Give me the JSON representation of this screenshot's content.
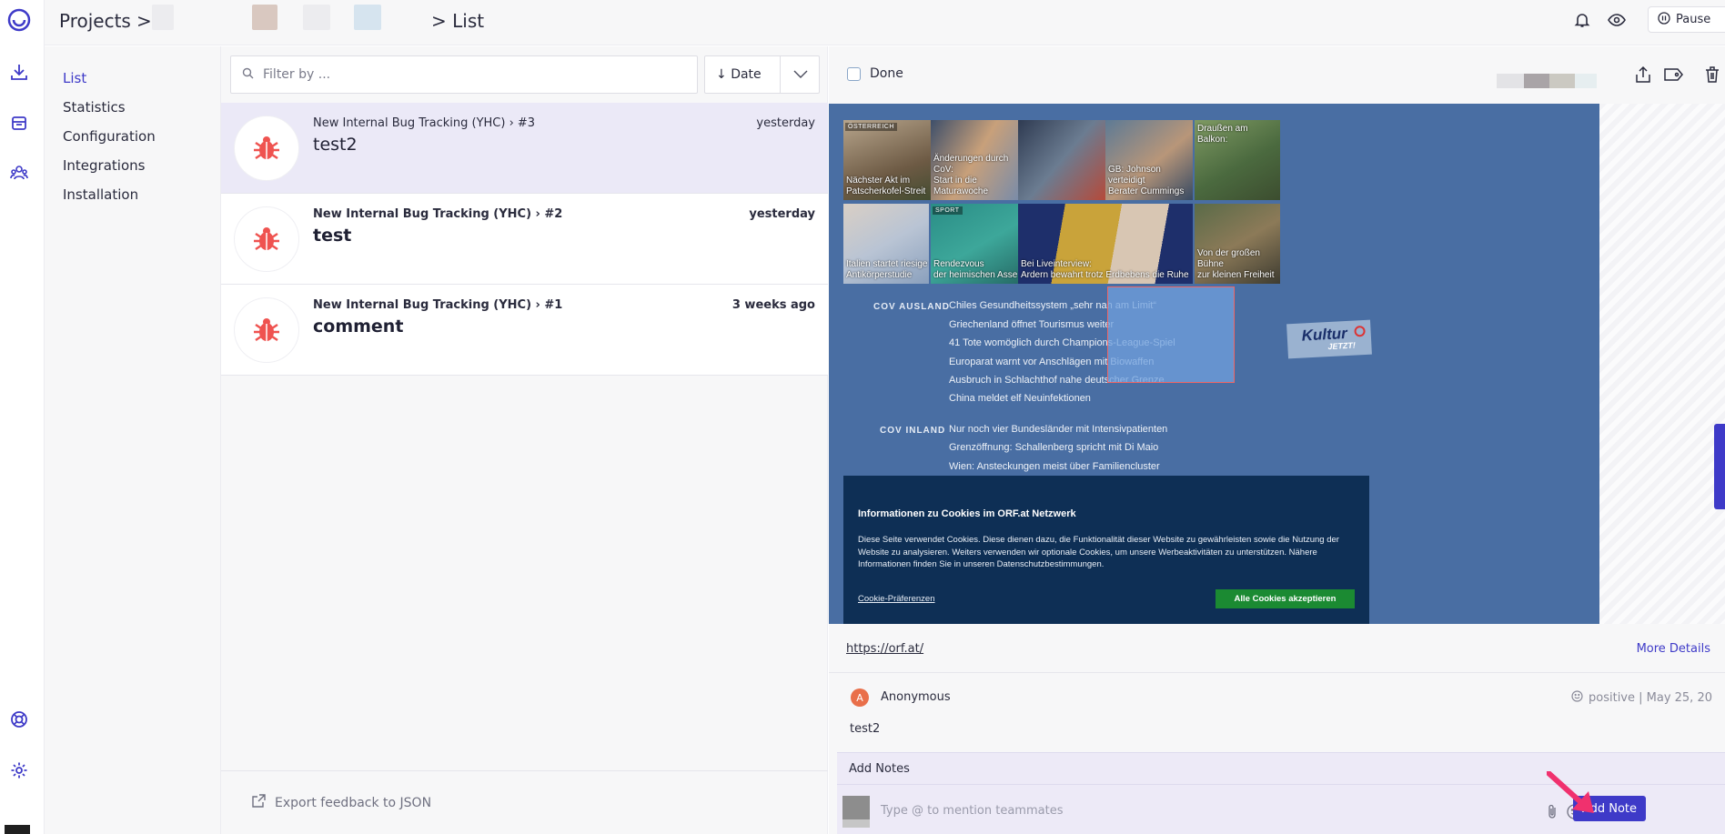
{
  "breadcrumb": {
    "projects": "Projects",
    "chevron": ">",
    "list": "> List"
  },
  "topbar": {
    "pause_label": "Pause"
  },
  "subnav": {
    "items": [
      {
        "label": "List",
        "active": true
      },
      {
        "label": "Statistics"
      },
      {
        "label": "Configuration"
      },
      {
        "label": "Integrations"
      },
      {
        "label": "Installation"
      }
    ]
  },
  "list": {
    "filter_placeholder": "Filter by ...",
    "sort_label": "Date",
    "items": [
      {
        "project": "New Internal Bug Tracking (YHC) › #3",
        "title": "test2",
        "time": "yesterday",
        "selected": true,
        "unread": false
      },
      {
        "project": "New Internal Bug Tracking (YHC) › #2",
        "title": "test",
        "time": "yesterday",
        "selected": false,
        "unread": true
      },
      {
        "project": "New Internal Bug Tracking (YHC) › #1",
        "title": "comment",
        "time": "3 weeks ago",
        "selected": false,
        "unread": true
      }
    ],
    "export_label": "Export feedback to JSON"
  },
  "detail": {
    "done_label": "Done",
    "url": "https://orf.at/",
    "more_details": "More Details",
    "comment": {
      "avatar_letter": "A",
      "author": "Anonymous",
      "meta": "positive | May 25, 20",
      "text": "test2"
    },
    "notes_tab": "Add Notes",
    "notes_placeholder": "Type @ to mention teammates",
    "add_note_label": "Add Note"
  },
  "screenshot": {
    "tiles": [
      {
        "tag": "ÖSTERREICH",
        "caption": "Nächster Akt im\nPatscherkofel-Streit"
      },
      {
        "tag": "",
        "caption": "Änderungen durch CoV:\nStart in die Maturawoche"
      },
      {
        "tag": "",
        "caption": "GB: Johnson verteidigt\nBerater Cummings"
      },
      {
        "tag": "",
        "caption": "Draußen am Balkon:"
      },
      {
        "tag": "",
        "caption": "Italien startet riesige\nAntikörperstudie"
      },
      {
        "tag": "SPORT",
        "caption": "Rendezvous\nder heimischen Asse"
      },
      {
        "tag": "",
        "caption": "Bei Liveinterview:\nArdern bewahrt trotz Erdbebens die Ruhe"
      },
      {
        "tag": "",
        "caption": "Von der großen Bühne\nzur kleinen Freiheit"
      }
    ],
    "section_ausland": "COV AUSLAND",
    "ausland": [
      "Chiles Gesundheitssystem „sehr nah am Limit“",
      "Griechenland öffnet Tourismus weiter",
      "41 Tote womöglich durch Champions-League-Spiel",
      "Europarat warnt vor Anschlägen mit Biowaffen",
      "Ausbruch in Schlachthof nahe deutscher Grenze",
      "China meldet elf Neuinfektionen"
    ],
    "section_inland": "COV INLAND",
    "inland": [
      "Nur noch vier Bundesländer mit Intensivpatienten",
      "Grenzöffnung: Schallenberg spricht mit Di Maio",
      "Wien: Ansteckungen meist über Familiencluster"
    ],
    "kultur_1": "Kultur",
    "kultur_2": "JETZT!",
    "cookie_title": "Informationen zu Cookies im ORF.at Netzwerk",
    "cookie_body": "Diese Seite verwendet Cookies. Diese dienen dazu, die Funktionalität dieser Website zu gewährleisten sowie die Nutzung der Website zu analysieren. Weiters verwenden wir optionale Cookies, um unsere Werbeaktivitäten zu unterstützen. Nähere Informationen finden Sie in unseren Datenschutzbestimmungen.",
    "cookie_link": "Cookie-Präferenzen",
    "cookie_button": "Alle Cookies akzeptieren"
  },
  "colors": {
    "accent": "#3e3ac8",
    "bug": "#ef5350",
    "selected_row": "#ebe9f7",
    "cookie_button": "#1b8a32"
  },
  "icons": [
    "logo-icon",
    "download-icon",
    "inbox-icon",
    "team-icon",
    "help-icon",
    "gear-icon",
    "bell-icon",
    "eye-icon",
    "pause-icon",
    "search-icon",
    "sort-down-icon",
    "chevron-down-icon",
    "bug-icon",
    "export-icon",
    "share-icon",
    "tag-icon",
    "trash-icon",
    "attach-icon",
    "emoji-icon"
  ]
}
